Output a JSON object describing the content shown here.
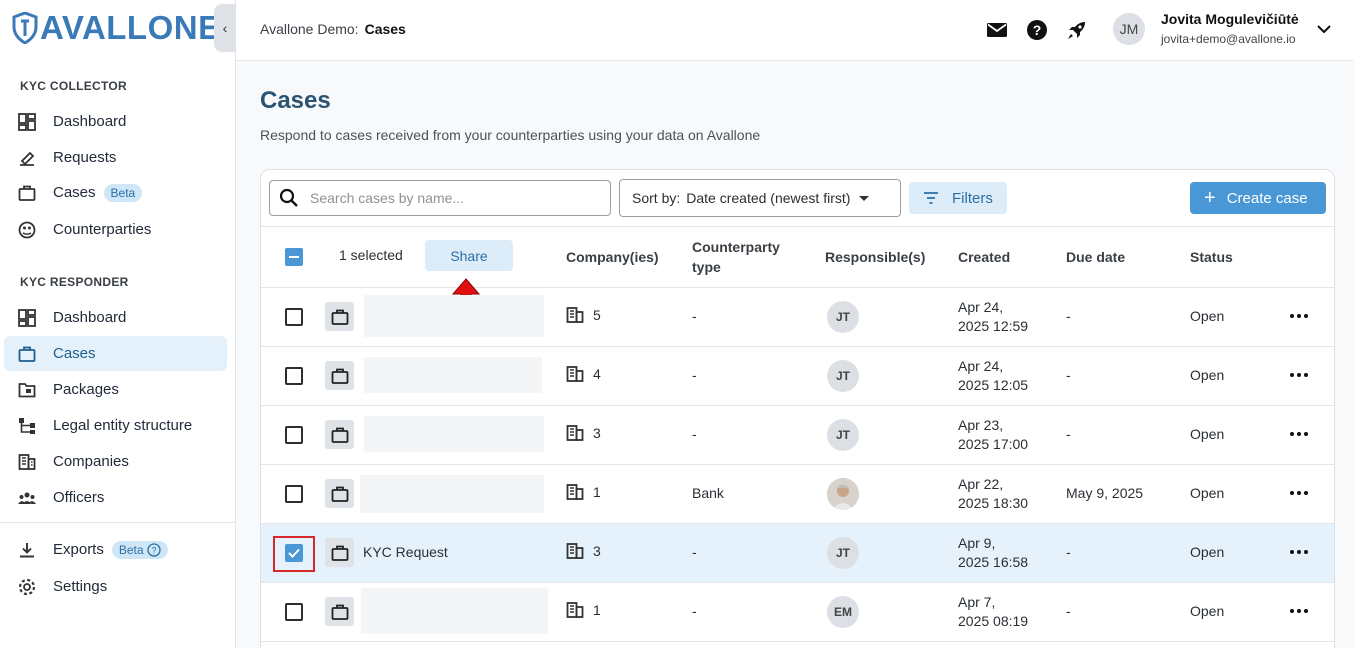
{
  "logo": {
    "text": "AVALLONE"
  },
  "sidebar": {
    "collector_label": "KYC COLLECTOR",
    "collector_items": [
      {
        "label": "Dashboard",
        "icon": "dashboard-icon"
      },
      {
        "label": "Requests",
        "icon": "requests-icon"
      },
      {
        "label": "Cases",
        "icon": "briefcase-icon",
        "badge": "Beta"
      },
      {
        "label": "Counterparties",
        "icon": "counterparties-icon"
      }
    ],
    "responder_label": "KYC RESPONDER",
    "responder_items": [
      {
        "label": "Dashboard",
        "icon": "dashboard-icon"
      },
      {
        "label": "Cases",
        "icon": "briefcase-icon",
        "active": true
      },
      {
        "label": "Packages",
        "icon": "packages-icon"
      },
      {
        "label": "Legal entity structure",
        "icon": "structure-icon"
      },
      {
        "label": "Companies",
        "icon": "building-icon"
      },
      {
        "label": "Officers",
        "icon": "officers-icon"
      }
    ],
    "bottom_items": [
      {
        "label": "Exports",
        "icon": "download-icon",
        "badge": "Beta"
      },
      {
        "label": "Settings",
        "icon": "gear-icon"
      }
    ]
  },
  "header": {
    "org": "Avallone Demo:",
    "page": "Cases",
    "user_initials": "JM",
    "user_name": "Jovita Mogulevičiūtė",
    "user_email": "jovita+demo@avallone.io"
  },
  "page": {
    "title": "Cases",
    "subtitle": "Respond to cases received from your counterparties using your data on Avallone"
  },
  "toolbar": {
    "search_placeholder": "Search cases by name...",
    "sort_label": "Sort by:",
    "sort_value": "Date created (newest first)",
    "filters_label": "Filters",
    "create_label": "Create case"
  },
  "table": {
    "selected_text": "1 selected",
    "share_label": "Share",
    "headers": {
      "companies": "Company(ies)",
      "counterparty_type_line1": "Counterparty",
      "counterparty_type_line2": "type",
      "responsible": "Responsible(s)",
      "created": "Created",
      "due_date": "Due date",
      "status": "Status"
    },
    "rows": [
      {
        "name": "",
        "companies": "5",
        "ctype": "-",
        "responsible": "JT",
        "created_date": "Apr 24,",
        "created_time": "2025 12:59",
        "due": "-",
        "status": "Open",
        "checked": false
      },
      {
        "name": "",
        "companies": "4",
        "ctype": "-",
        "responsible": "JT",
        "created_date": "Apr 24,",
        "created_time": "2025 12:05",
        "due": "-",
        "status": "Open",
        "checked": false
      },
      {
        "name": "",
        "companies": "3",
        "ctype": "-",
        "responsible": "JT",
        "created_date": "Apr 23,",
        "created_time": "2025 17:00",
        "due": "-",
        "status": "Open",
        "checked": false
      },
      {
        "name": "",
        "companies": "1",
        "ctype": "Bank",
        "responsible": "",
        "created_date": "Apr 22,",
        "created_time": "2025 18:30",
        "due": "May 9, 2025",
        "status": "Open",
        "checked": false
      },
      {
        "name": "KYC Request",
        "companies": "3",
        "ctype": "-",
        "responsible": "JT",
        "created_date": "Apr 9,",
        "created_time": "2025 16:58",
        "due": "-",
        "status": "Open",
        "checked": true
      },
      {
        "name": "",
        "companies": "1",
        "ctype": "-",
        "responsible": "EM",
        "created_date": "Apr 7,",
        "created_time": "2025 08:19",
        "due": "-",
        "status": "Open",
        "checked": false
      }
    ]
  },
  "colors": {
    "accent": "#4a97d6",
    "brand": "#3a7ab8",
    "title": "#2b5372",
    "highlight": "#d62828"
  }
}
